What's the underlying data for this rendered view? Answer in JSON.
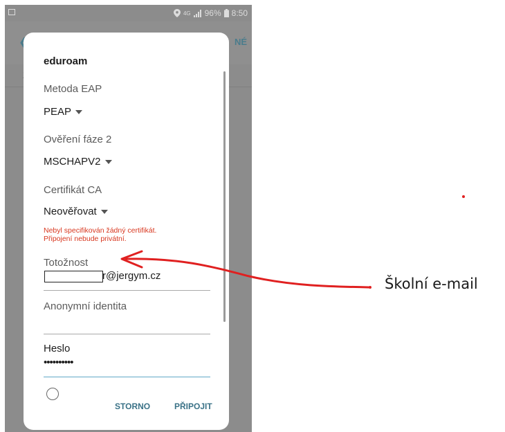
{
  "statusbar": {
    "signal_label": "4G",
    "battery": "96%",
    "time": "8:50"
  },
  "background": {
    "back_icon": "back-arrow-icon",
    "next_label": "NÉ",
    "mark": "Z"
  },
  "dialog": {
    "title": "eduroam",
    "eap_method": {
      "label": "Metoda EAP",
      "value": "PEAP"
    },
    "phase2": {
      "label": "Ověření fáze 2",
      "value": "MSCHAPV2"
    },
    "ca_cert": {
      "label": "Certifikát CA",
      "value": "Neověřovat"
    },
    "warning": [
      "Nebyl specifikován žádný certifikát.",
      "Připojení nebude privátní."
    ],
    "identity": {
      "label": "Totožnost",
      "value_visible": "r@jergym.cz"
    },
    "anonymous_identity": {
      "label": "Anonymní identita",
      "value": ""
    },
    "password": {
      "label": "Heslo",
      "value": "••••••••••"
    },
    "buttons": {
      "cancel": "STORNO",
      "connect": "PŘIPOJIT"
    }
  },
  "annotation": {
    "callout": "Školní e-mail",
    "arrow_color": "#e02020"
  }
}
